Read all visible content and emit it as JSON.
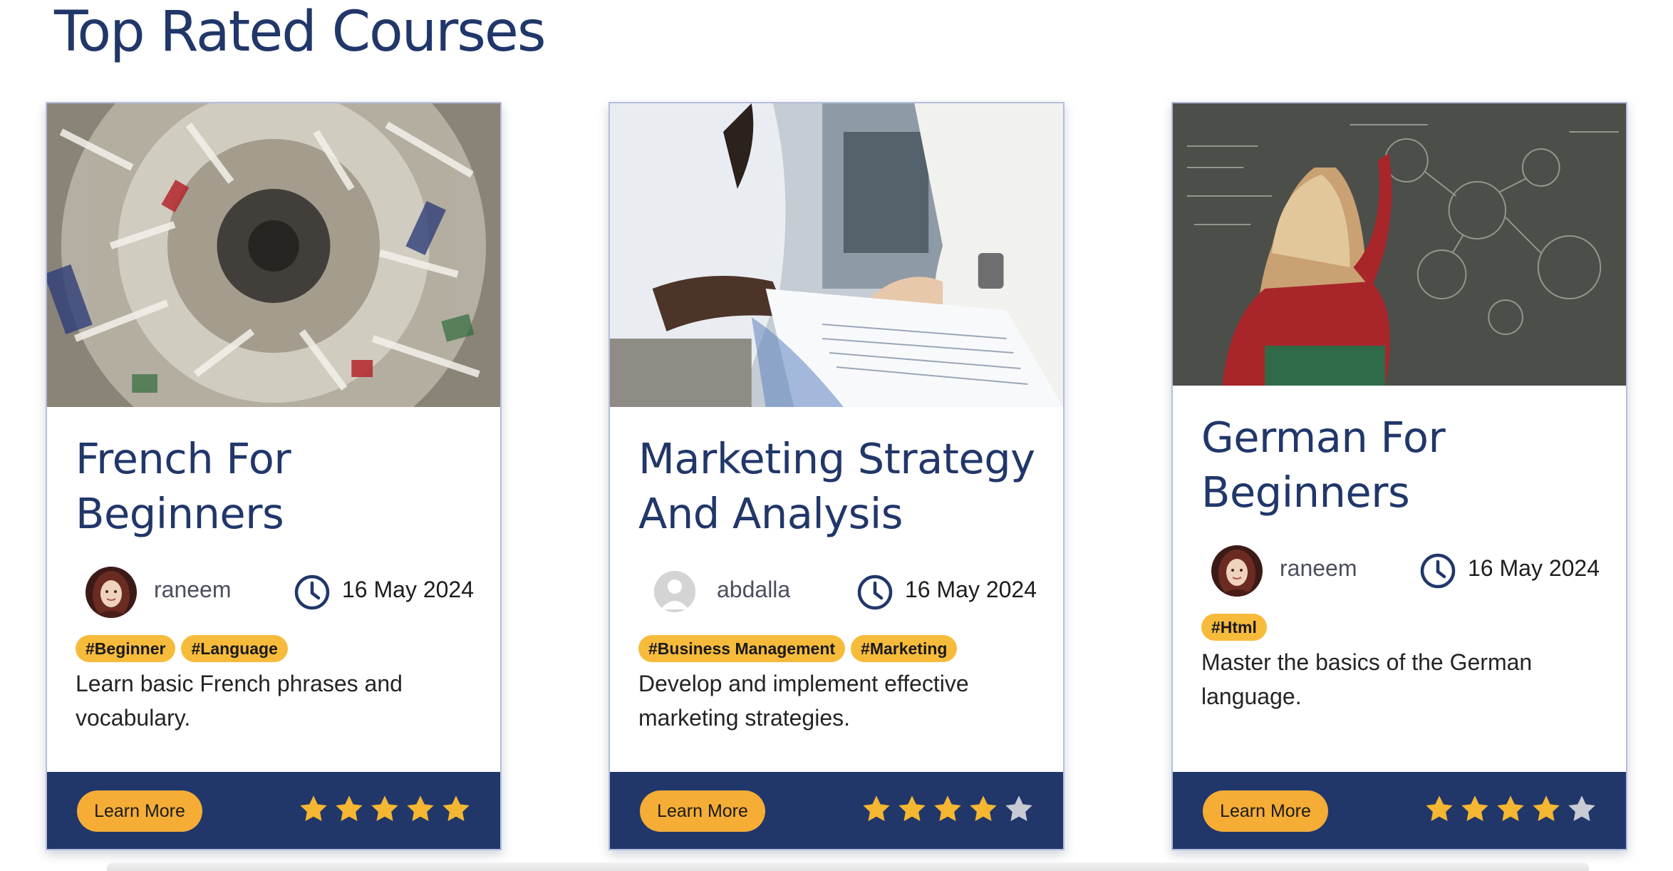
{
  "section": {
    "title": "Top Rated Courses"
  },
  "colors": {
    "navy": "#21376a",
    "accent": "#f5ad36",
    "tag": "#f7bb3c",
    "star_on": "#f5b731",
    "star_off": "#c8cbd4"
  },
  "courses": [
    {
      "title_line1": "French For",
      "title_line2": "Beginners",
      "author": "raneem",
      "avatar": "hijab-woman-avatar",
      "date": "16 May 2024",
      "tags": [
        "#Beginner",
        "#Language"
      ],
      "desc_line1": "Learn basic French phrases and",
      "desc_line2": "vocabulary.",
      "button": "Learn More",
      "rating": 5
    },
    {
      "title_line1": "Marketing Strategy",
      "title_line2": "And Analysis",
      "author": "abdalla",
      "avatar": "default-user-avatar",
      "date": "16 May 2024",
      "tags": [
        "#Business Management",
        "#Marketing"
      ],
      "desc_line1": "Develop and implement effective",
      "desc_line2": "marketing strategies.",
      "button": "Learn More",
      "rating": 4
    },
    {
      "title_line1": "German For",
      "title_line2": "Beginners",
      "author": "raneem",
      "avatar": "hijab-woman-avatar",
      "date": "16 May 2024",
      "tags": [
        "#Html"
      ],
      "desc_line1": "Master the basics of the German",
      "desc_line2": "language.",
      "button": "Learn More",
      "rating": 4
    }
  ]
}
